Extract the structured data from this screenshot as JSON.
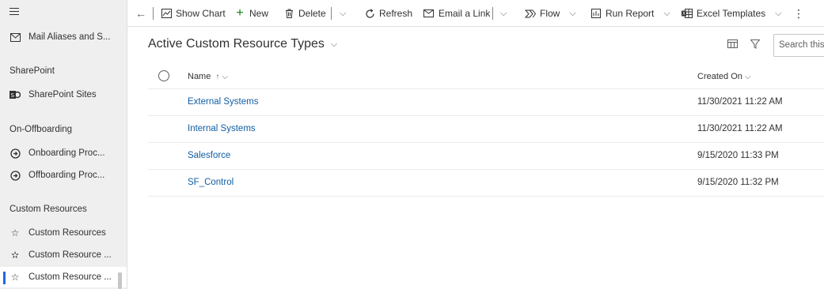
{
  "sidebar": {
    "items_top": [
      {
        "label": "Mail Aliases and S...",
        "icon": "mail-icon"
      }
    ],
    "groups": [
      {
        "title": "SharePoint",
        "items": [
          {
            "label": "SharePoint Sites",
            "icon": "sharepoint-icon"
          }
        ]
      },
      {
        "title": "On-Offboarding",
        "items": [
          {
            "label": "Onboarding Proc...",
            "icon": "process-icon"
          },
          {
            "label": "Offboarding Proc...",
            "icon": "process-icon"
          }
        ]
      },
      {
        "title": "Custom Resources",
        "items": [
          {
            "label": "Custom Resources",
            "icon": "star-icon"
          },
          {
            "label": "Custom Resource ...",
            "icon": "star-gear-icon"
          },
          {
            "label": "Custom Resource ...",
            "icon": "star-icon",
            "selected": true
          }
        ]
      }
    ]
  },
  "commandbar": {
    "back": "←",
    "show_chart": "Show Chart",
    "new": "New",
    "delete": "Delete",
    "refresh": "Refresh",
    "email_link": "Email a Link",
    "flow": "Flow",
    "run_report": "Run Report",
    "excel_templates": "Excel Templates",
    "more": "⋮"
  },
  "view": {
    "title": "Active Custom Resource Types",
    "search_placeholder": "Search this view"
  },
  "grid": {
    "columns": {
      "name": "Name",
      "created_on": "Created On"
    },
    "sort_arrow": "↑",
    "rows": [
      {
        "name": "External Systems",
        "created_on": "11/30/2021 11:22 AM"
      },
      {
        "name": "Internal Systems",
        "created_on": "11/30/2021 11:22 AM"
      },
      {
        "name": "Salesforce",
        "created_on": "9/15/2020 11:33 PM"
      },
      {
        "name": "SF_Control",
        "created_on": "9/15/2020 11:32 PM"
      }
    ]
  },
  "colors": {
    "link": "#115ea3",
    "accent": "#2266e3",
    "sidebar_bg": "#efefef"
  }
}
